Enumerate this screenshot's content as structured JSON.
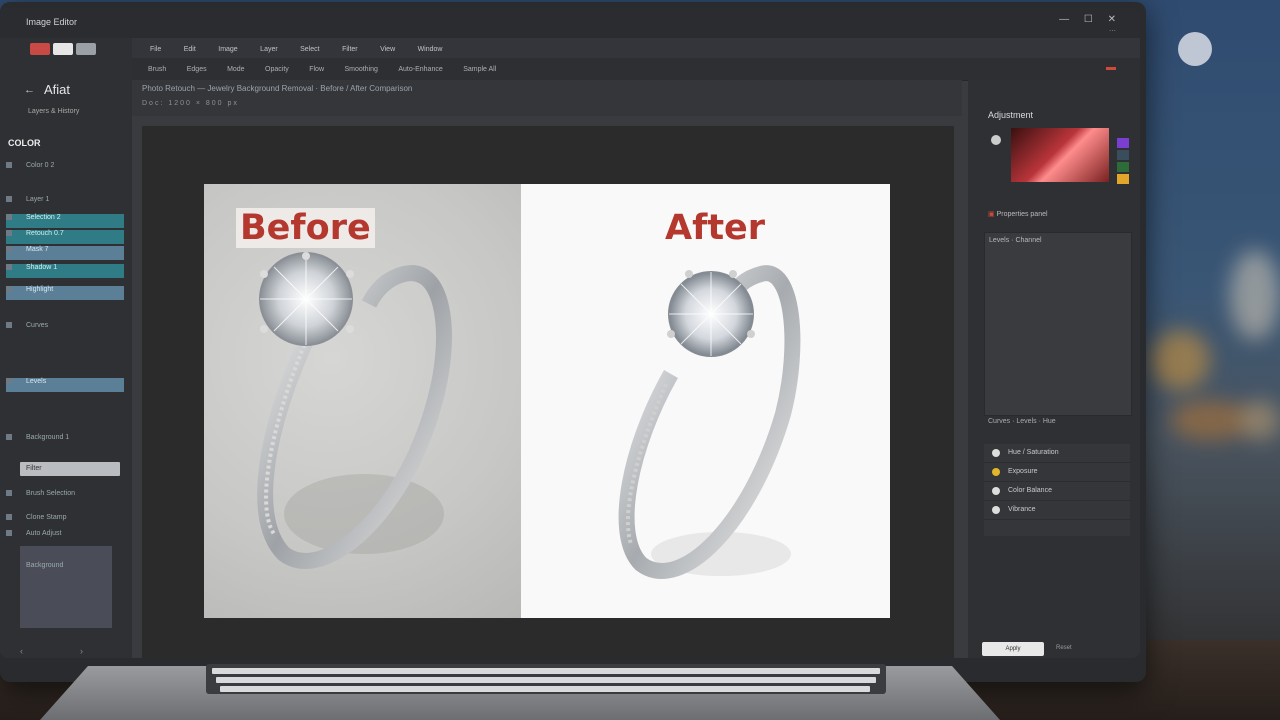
{
  "window": {
    "title": "Image Editor",
    "controls": "— ☐ ✕"
  },
  "left_panel": {
    "app_name": "Afiat",
    "subtitle": "Layers & History",
    "color_heading": "COLOR",
    "layers": [
      "Color 0 2",
      "Layer 1",
      "Selection 2",
      "Retouch 0.7",
      "Mask 7",
      "Shadow 1",
      "Highlight",
      "Curves",
      "Levels",
      "Background 1"
    ],
    "input_value": "Filter",
    "history": [
      "Brush Selection",
      "Clone Stamp",
      "Auto Adjust",
      "Background"
    ]
  },
  "menu": [
    "File",
    "Edit",
    "Image",
    "Layer",
    "Select",
    "Filter",
    "View",
    "Window"
  ],
  "options_bar": [
    "Brush",
    "Edges",
    "Mode",
    "Opacity",
    "Flow",
    "Smoothing",
    "Auto-Enhance",
    "Sample All"
  ],
  "info_bar": {
    "line1": "Photo Retouch — Jewelry Background Removal · Before / After Comparison",
    "line2": "Doc: 1200 × 800 px"
  },
  "document": {
    "before_label": "Before",
    "after_label": "After"
  },
  "right_panel": {
    "title": "Adjustment",
    "swatch_colors": [
      "#7a3fd0",
      "#3a4d5c",
      "#2e6b3b",
      "#e3a52a"
    ],
    "row1": "Properties panel",
    "panel_header": "Levels · Channel",
    "caption": "Curves · Levels · Hue",
    "items": [
      "Hue / Saturation",
      "Exposure",
      "Color Balance",
      "Vibrance"
    ],
    "button": "Apply",
    "button2": "Reset"
  },
  "colors": {
    "accent_label": "#b5382f",
    "selection": "#5b7f97",
    "highlight_cyan": "#2f7b86"
  }
}
